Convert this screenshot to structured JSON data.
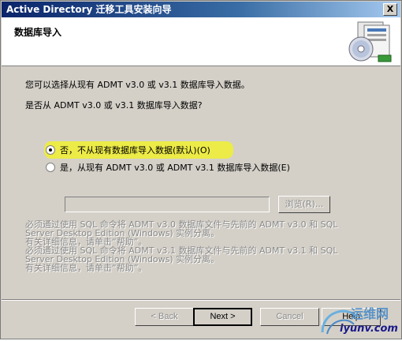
{
  "window": {
    "title": "Active Directory 迁移工具安装向导",
    "close_label": "X"
  },
  "header": {
    "title": "数据库导入",
    "icon": "install-wizard-icon"
  },
  "body": {
    "line1": "您可以选择从现有 ADMT v3.0 或 v3.1 数据库导入数据。",
    "line2": "是否从 ADMT v3.0 或 v3.1 数据库导入数据?",
    "options": [
      {
        "label": "否，不从现有数据库导入数据(默认)(O)",
        "checked": true
      },
      {
        "label": "是，从现有 ADMT v3.0 或 ADMT v3.1 数据库导入数据(E)",
        "checked": false
      }
    ],
    "path_value": "",
    "browse_label": "浏览(R)...",
    "note_lines": [
      "必须通过使用 SQL 命令将 ADMT v3.0 数据库文件与先前的 ADMT v3.0 和 SQL",
      "Server Desktop Edition (Windows) 实例分离。",
      "有关详细信息，请单击“帮助”。",
      "必须通过使用 SQL 命令将 ADMT v3.1 数据库文件与先前的 ADMT v3.1 和 SQL",
      "Server Desktop Edition (Windows) 实例分离。",
      "有关详细信息，请单击“帮助”。"
    ]
  },
  "footer": {
    "back_label": "< Back",
    "next_label": "Next >",
    "cancel_label": "Cancel",
    "help_label": "Help"
  },
  "watermark": {
    "text1": "运维网",
    "text2": "iyunv.com"
  },
  "colors": {
    "title_bar": "#0a246a",
    "highlight": "#f0f030",
    "dialog_bg": "#d4d0c8"
  }
}
